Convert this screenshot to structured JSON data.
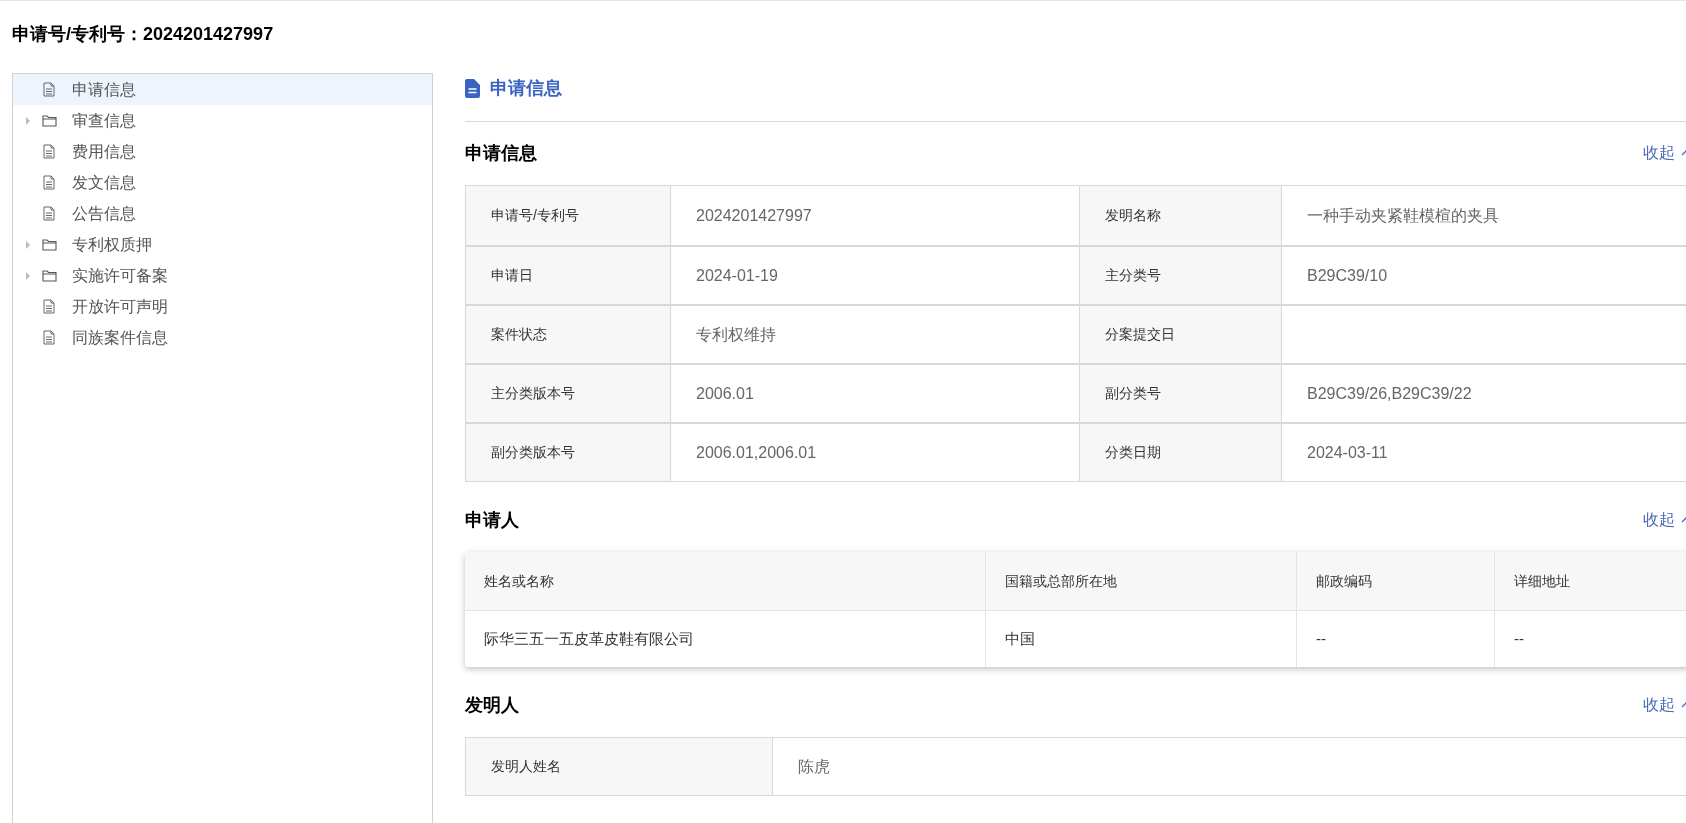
{
  "page_title": "申请号/专利号：2024201427997",
  "tree": [
    {
      "label": "申请信息",
      "kind": "file",
      "selected": true
    },
    {
      "label": "审查信息",
      "kind": "folder",
      "selected": false,
      "expanded": false
    },
    {
      "label": "费用信息",
      "kind": "file",
      "selected": false
    },
    {
      "label": "发文信息",
      "kind": "file",
      "selected": false
    },
    {
      "label": "公告信息",
      "kind": "file",
      "selected": false
    },
    {
      "label": "专利权质押",
      "kind": "folder",
      "selected": false,
      "expanded": false
    },
    {
      "label": "实施许可备案",
      "kind": "folder",
      "selected": false,
      "expanded": false
    },
    {
      "label": "开放许可声明",
      "kind": "file",
      "selected": false
    },
    {
      "label": "同族案件信息",
      "kind": "file",
      "selected": false
    }
  ],
  "panel_title": "申请信息",
  "sections": [
    {
      "kind": "pairs",
      "title": "申请信息",
      "toggle": "收起",
      "rows": [
        [
          "申请号/专利号",
          "2024201427997",
          "发明名称",
          "一种手动夹紧鞋模楦的夹具"
        ],
        [
          "申请日",
          "2024-01-19",
          "主分类号",
          "B29C39/10"
        ],
        [
          "案件状态",
          "专利权维持",
          "分案提交日",
          ""
        ],
        [
          "主分类版本号",
          "2006.01",
          "副分类号",
          "B29C39/26,B29C39/22"
        ],
        [
          "副分类版本号",
          "2006.01,2006.01",
          "分类日期",
          "2024-03-11"
        ]
      ]
    },
    {
      "kind": "grid",
      "title": "申请人",
      "toggle": "收起",
      "columns": [
        "姓名或名称",
        "国籍或总部所在地",
        "邮政编码",
        "详细地址"
      ],
      "rows": [
        [
          "际华三五一五皮革皮鞋有限公司",
          "中国",
          "--",
          "--"
        ]
      ]
    },
    {
      "kind": "pairs",
      "title": "发明人",
      "toggle": "收起",
      "rows": [
        [
          "发明人姓名",
          "陈虎"
        ]
      ]
    }
  ]
}
